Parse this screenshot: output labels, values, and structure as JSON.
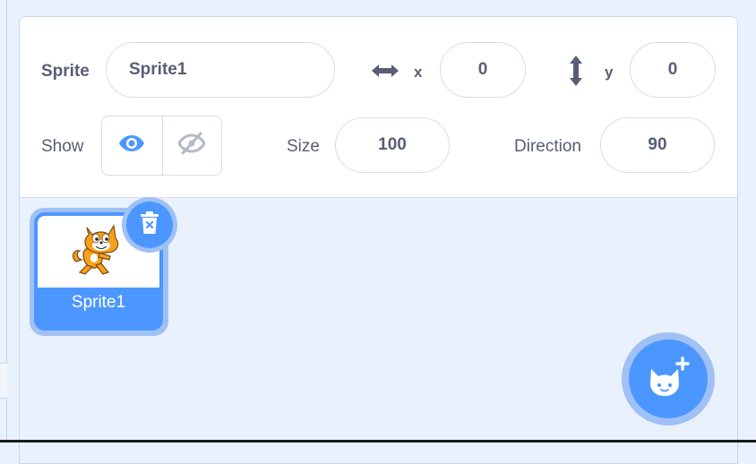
{
  "sprite_info": {
    "sprite_label": "Sprite",
    "sprite_name": "Sprite1",
    "x_label": "x",
    "x_value": "0",
    "y_label": "y",
    "y_value": "0",
    "show_label": "Show",
    "show_state": "visible",
    "size_label": "Size",
    "size_value": "100",
    "direction_label": "Direction",
    "direction_value": "90"
  },
  "sprite_list": {
    "items": [
      {
        "name": "Sprite1",
        "selected": true
      }
    ]
  },
  "icons": {
    "x_axis": "horizontal-arrows-icon",
    "y_axis": "vertical-arrows-icon",
    "show": "eye-icon",
    "hide": "eye-slash-icon",
    "delete": "trash-icon",
    "add_sprite": "cat-plus-icon",
    "thumbnail": "scratch-cat-icon"
  },
  "colors": {
    "accent": "#4c97ff",
    "accent_light": "#a0c1f6",
    "text": "#575e75",
    "pane_bg": "#e9f1fc",
    "border": "#d4dced"
  }
}
